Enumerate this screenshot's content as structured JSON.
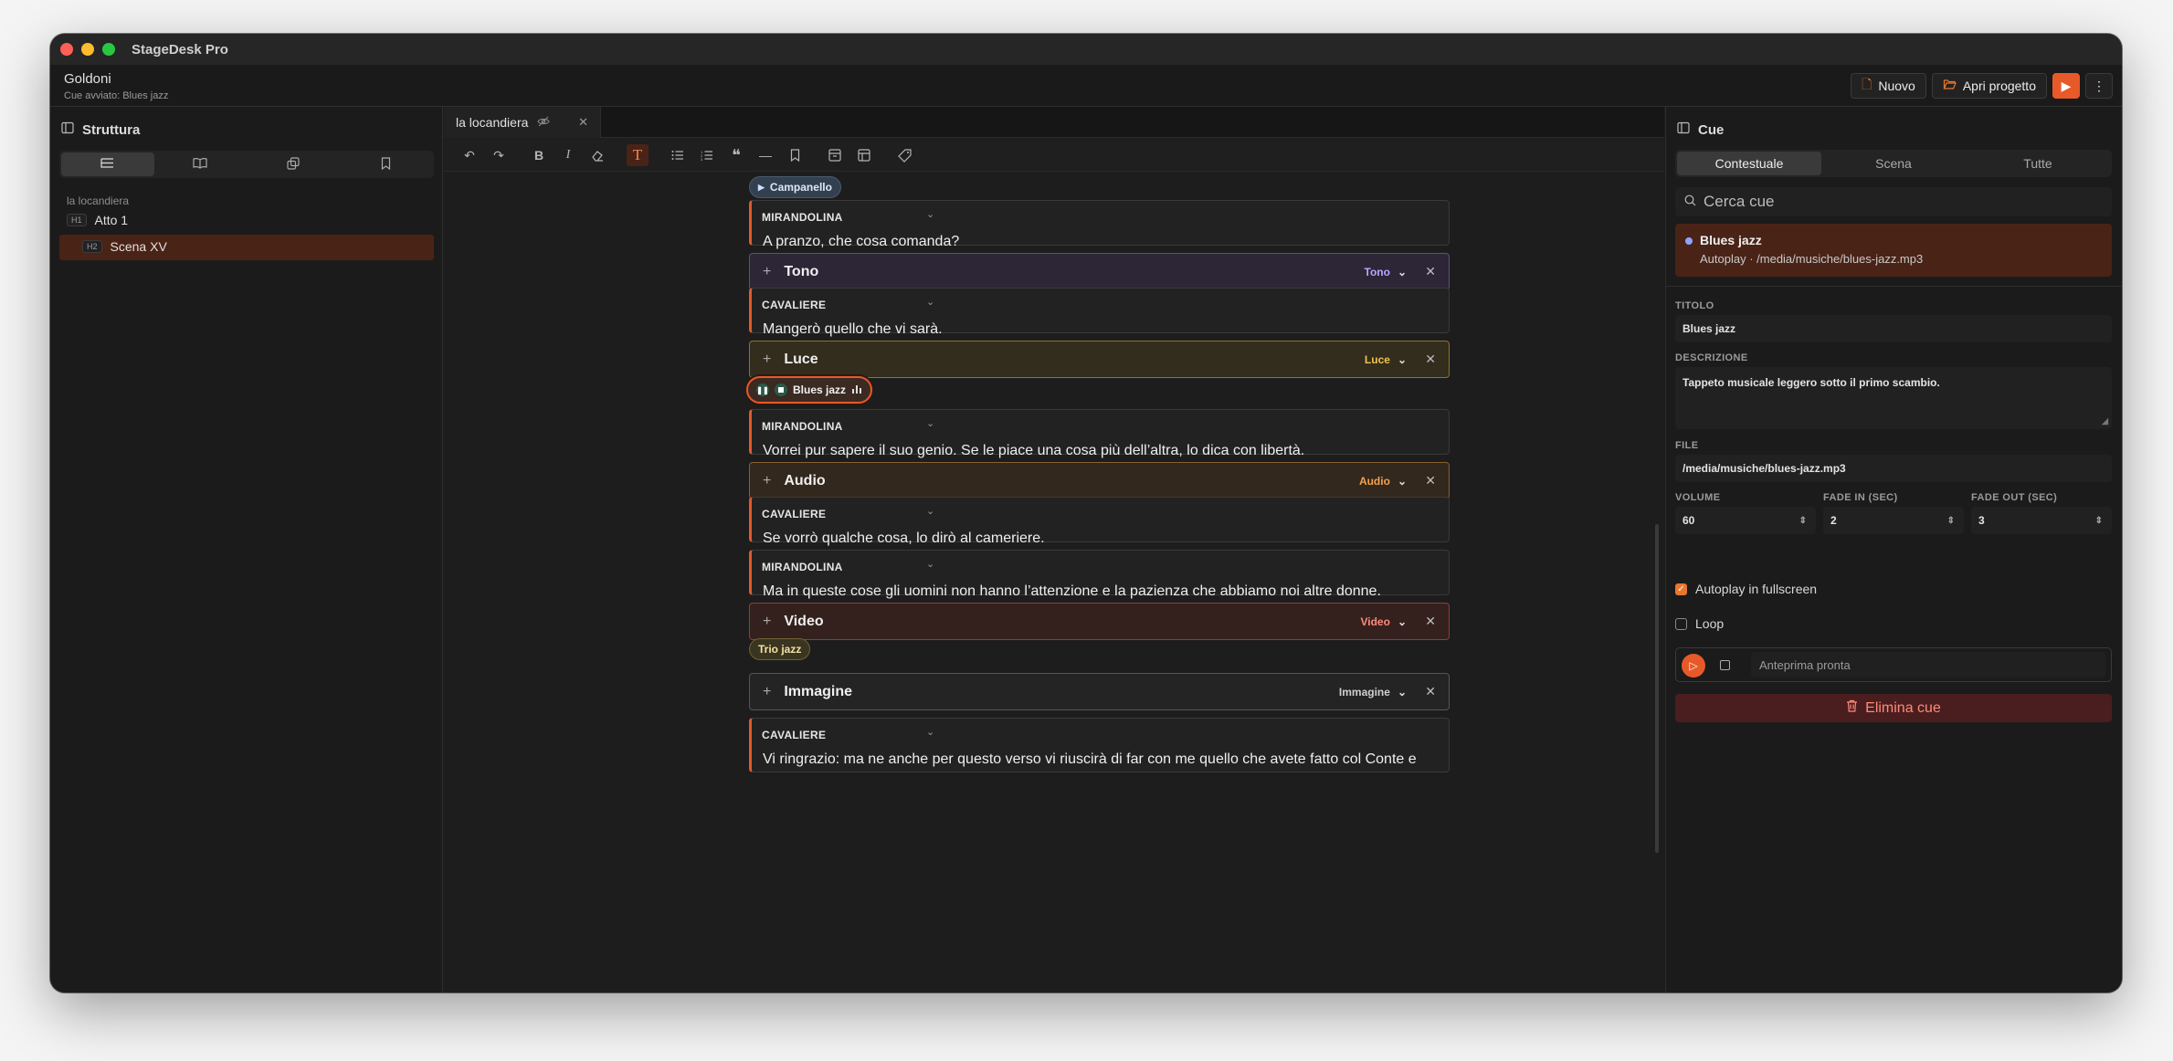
{
  "app": {
    "title": "StageDesk Pro"
  },
  "header": {
    "project_name": "Goldoni",
    "status": "Cue avviato: Blues jazz",
    "new_label": "Nuovo",
    "open_label": "Apri progetto"
  },
  "left_panel": {
    "title": "Struttura",
    "tree_root": "la locandiera",
    "items": [
      {
        "tag": "H1",
        "label": "Atto 1"
      },
      {
        "tag": "H2",
        "label": "Scena XV"
      }
    ]
  },
  "editor": {
    "tab_label": "la locandiera",
    "blocks": {
      "pill_campanello": "Campanello",
      "d1": {
        "speaker": "MIRANDOLINA",
        "line": "A pranzo, che cosa comanda?"
      },
      "c1": {
        "name": "Tono",
        "type": "Tono"
      },
      "d2": {
        "speaker": "CAVALIERE",
        "line": "Mangerò quello che vi sarà."
      },
      "c2": {
        "name": "Luce",
        "type": "Luce"
      },
      "pill_blues": "Blues jazz",
      "d3": {
        "speaker": "MIRANDOLINA",
        "line": "Vorrei pur sapere il suo genio. Se le piace una cosa più dell’altra, lo dica con libertà."
      },
      "c3": {
        "name": "Audio",
        "type": "Audio"
      },
      "d4": {
        "speaker": "CAVALIERE",
        "line": "Se vorrò qualche cosa, lo dirò al cameriere."
      },
      "d5": {
        "speaker": "MIRANDOLINA",
        "line": "Ma in queste cose gli uomini non hanno l’attenzione e la pazienza che abbiamo noi altre donne."
      },
      "c4": {
        "name": "Video",
        "type": "Video"
      },
      "pill_trio": "Trio jazz",
      "c5": {
        "name": "Immagine",
        "type": "Immagine"
      },
      "d6": {
        "speaker": "CAVALIERE",
        "line": "Vi ringrazio: ma ne anche per questo verso vi riuscirà di far con me quello che avete fatto col Conte e"
      }
    }
  },
  "right_panel": {
    "title": "Cue",
    "tabs": [
      "Contestuale",
      "Scena",
      "Tutte"
    ],
    "search_placeholder": "Cerca cue",
    "selected_cue": {
      "title": "Blues jazz",
      "subtitle": "Autoplay · /media/musiche/blues-jazz.mp3"
    },
    "labels": {
      "title": "TITOLO",
      "description": "DESCRIZIONE",
      "file": "FILE",
      "volume": "VOLUME",
      "fade_in": "FADE IN (SEC)",
      "fade_out": "FADE OUT (SEC)"
    },
    "values": {
      "title": "Blues jazz",
      "description": "Tappeto musicale leggero sotto il primo scambio.",
      "file": "/media/musiche/blues-jazz.mp3",
      "volume": "60",
      "fade_in": "2",
      "fade_out": "3"
    },
    "autoplay_label": "Autoplay in fullscreen",
    "loop_label": "Loop",
    "preview_status": "Anteprima pronta",
    "delete_label": "Elimina cue"
  },
  "colors": {
    "accent": "#e8592a",
    "selection": "#4a2317",
    "tono": "#b8a8ff",
    "luce": "#f2c14e",
    "audio": "#f2a24e",
    "video": "#ff8a7a",
    "immagine": "#cfcfcf"
  }
}
